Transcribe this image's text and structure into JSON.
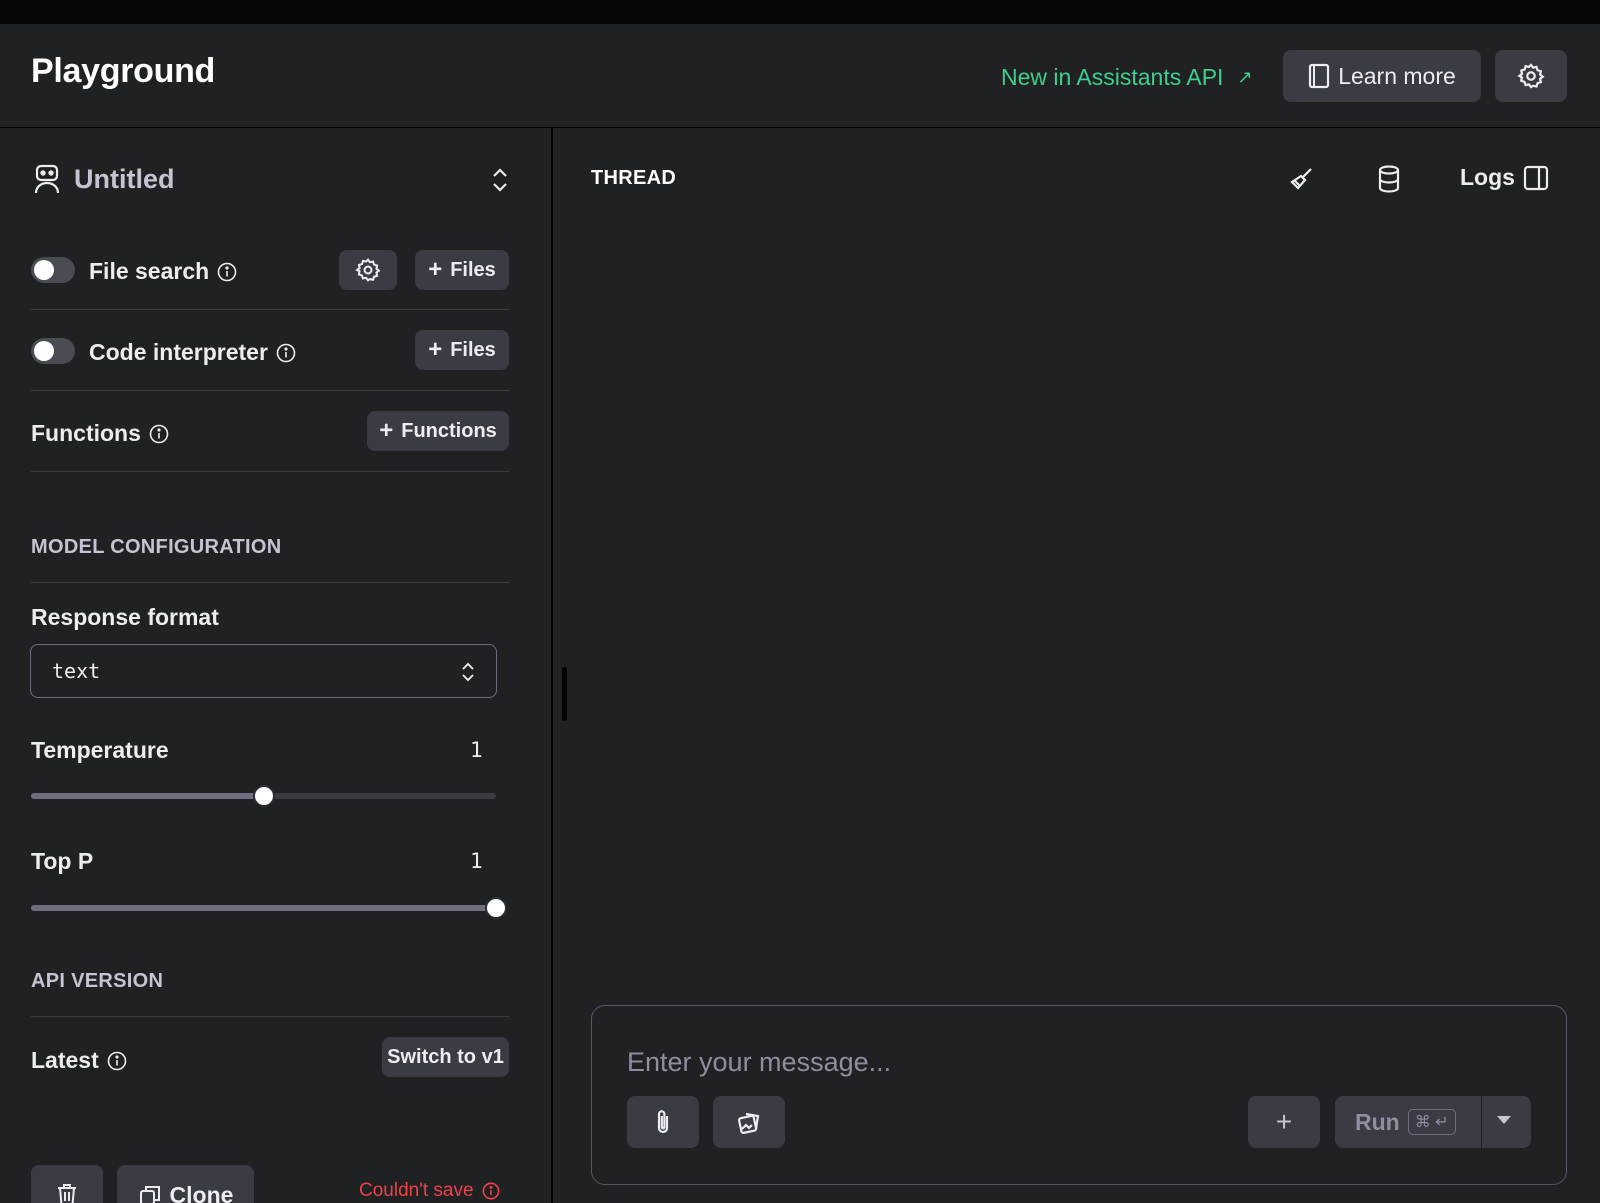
{
  "header": {
    "title": "Playground",
    "new_link": "New in Assistants API",
    "new_link_arrow": "↗",
    "learn_more": "Learn more"
  },
  "sidebar": {
    "assistant_name": "Untitled",
    "tools": {
      "file_search": {
        "label": "File search",
        "files_button": "Files",
        "enabled": false
      },
      "code_interpreter": {
        "label": "Code interpreter",
        "files_button": "Files",
        "enabled": false
      },
      "functions": {
        "label": "Functions",
        "button": "Functions"
      }
    },
    "model_config": {
      "section_title": "MODEL CONFIGURATION",
      "response_format_label": "Response format",
      "response_format_value": "text",
      "temperature_label": "Temperature",
      "temperature_value": "1",
      "temperature_fraction": 0.5,
      "top_p_label": "Top P",
      "top_p_value": "1",
      "top_p_fraction": 1.0
    },
    "api_version": {
      "section_title": "API VERSION",
      "label": "Latest",
      "switch_button": "Switch to v1"
    },
    "footer": {
      "clone_button": "Clone",
      "status": "Couldn't save"
    }
  },
  "thread": {
    "label": "THREAD",
    "logs_button": "Logs",
    "composer": {
      "placeholder": "Enter your message...",
      "run_button": "Run",
      "shortcut": "⌘ ↵",
      "add_button": "+"
    }
  },
  "colors": {
    "background": "#202123",
    "accent_green": "#3ecf8e",
    "error_red": "#ef4146",
    "button_bg": "#3a3b43"
  }
}
